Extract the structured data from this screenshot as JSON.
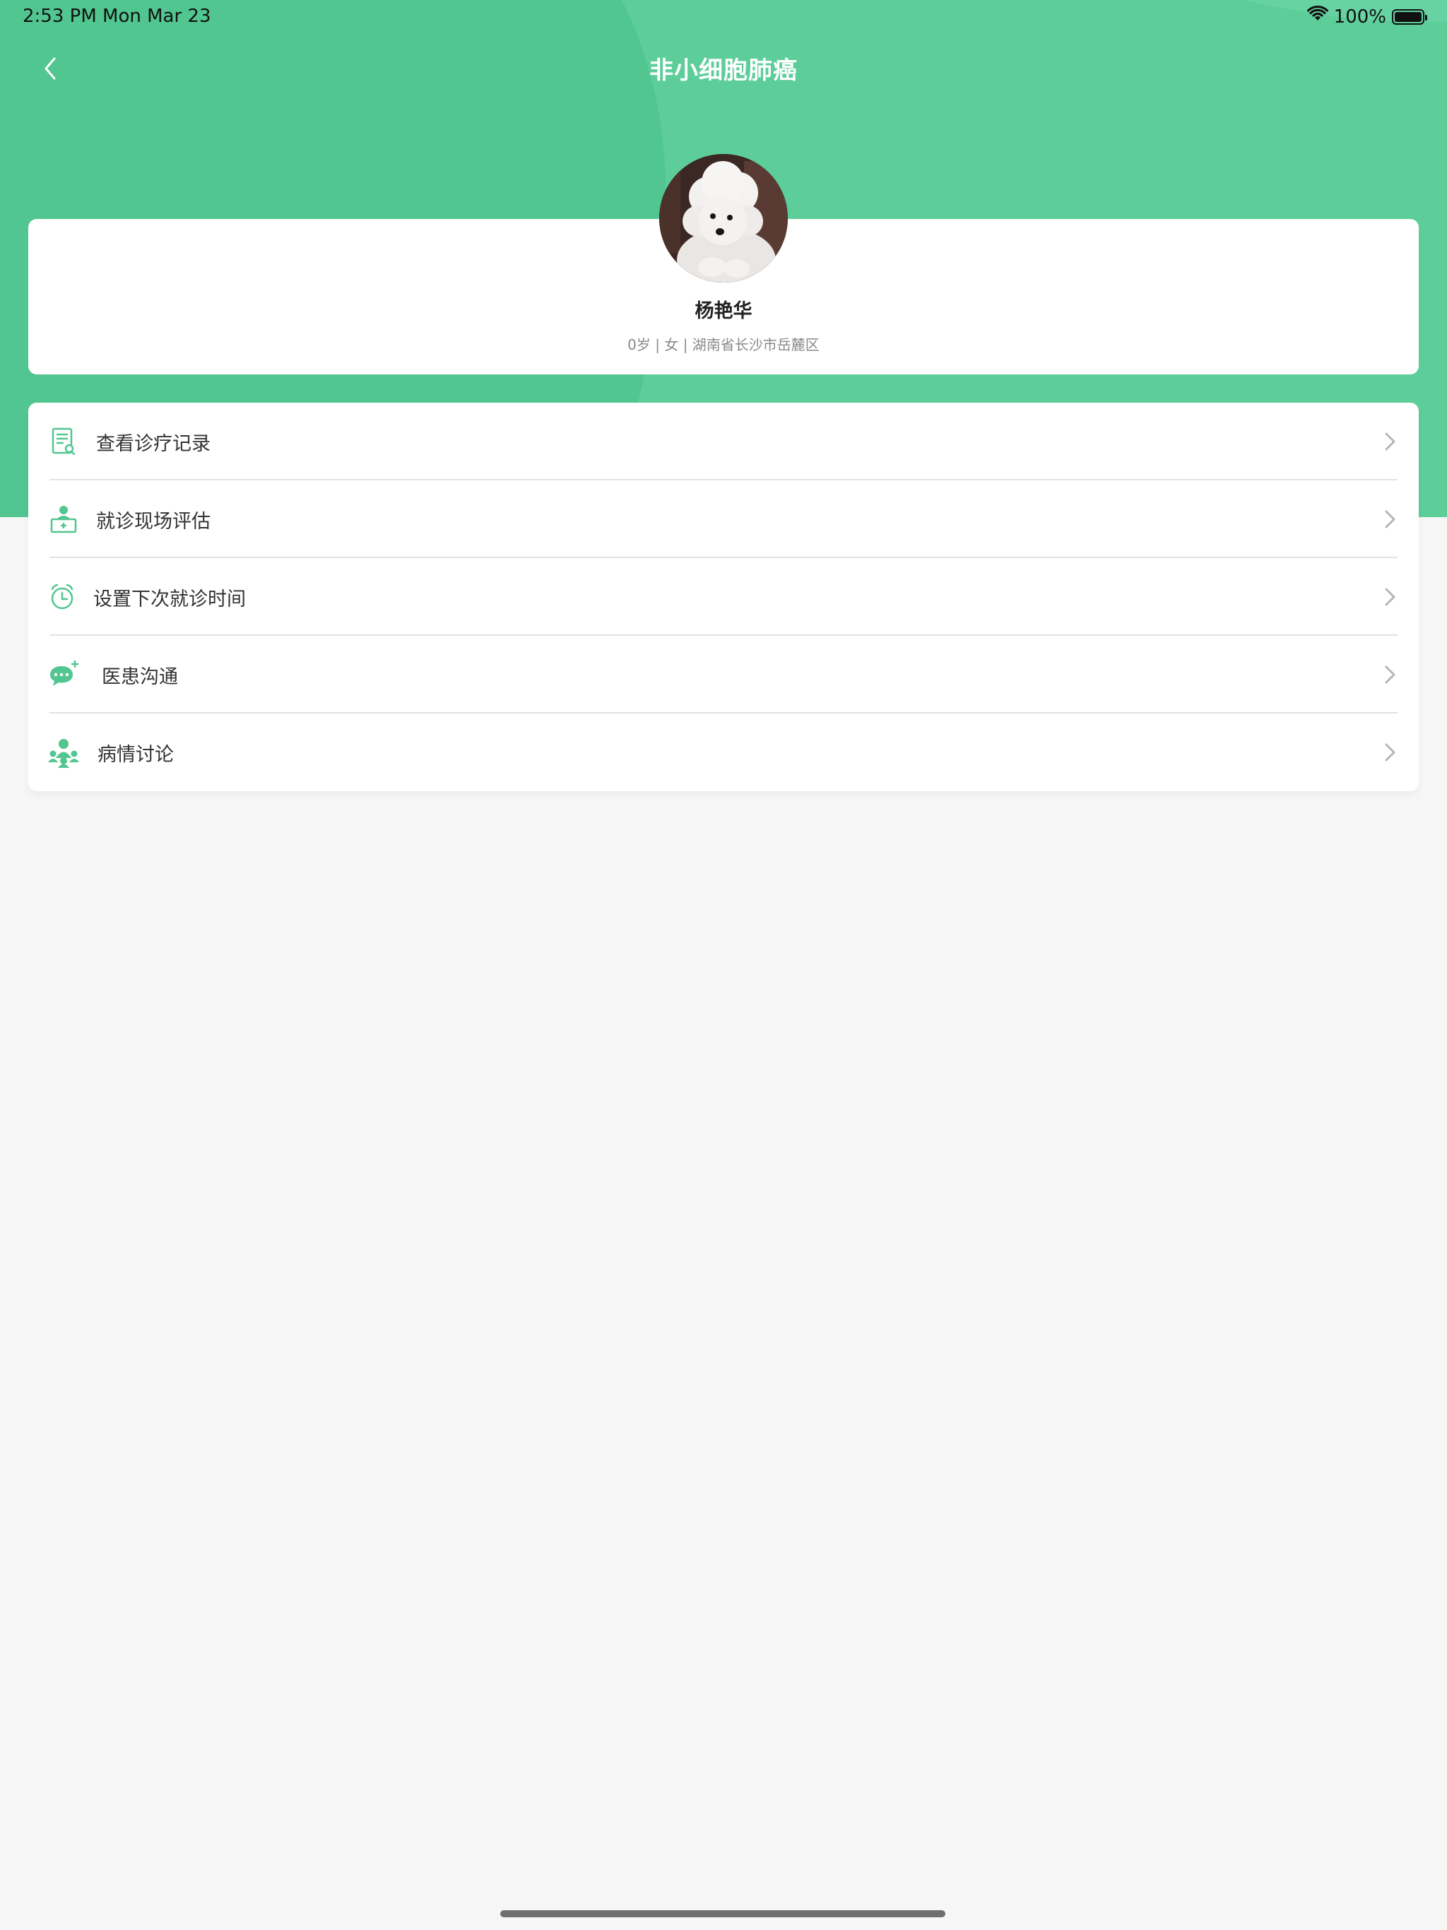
{
  "status_bar": {
    "time": "2:53 PM   Mon Mar 23",
    "battery": "100%"
  },
  "nav": {
    "title": "非小细胞肺癌"
  },
  "patient": {
    "name": "杨艳华",
    "info": "0岁 | 女 | 湖南省长沙市岳麓区"
  },
  "menu": {
    "items": [
      {
        "label": "查看诊疗记录",
        "icon": "medical-record-icon"
      },
      {
        "label": "就诊现场评估",
        "icon": "doctor-desk-icon"
      },
      {
        "label": "设置下次就诊时间",
        "icon": "alarm-clock-icon"
      },
      {
        "label": "医患沟通",
        "icon": "chat-bubble-icon"
      },
      {
        "label": "病情讨论",
        "icon": "group-discussion-icon"
      }
    ]
  },
  "colors": {
    "brand_green": "#52c690",
    "background": "#f6f6f6"
  }
}
